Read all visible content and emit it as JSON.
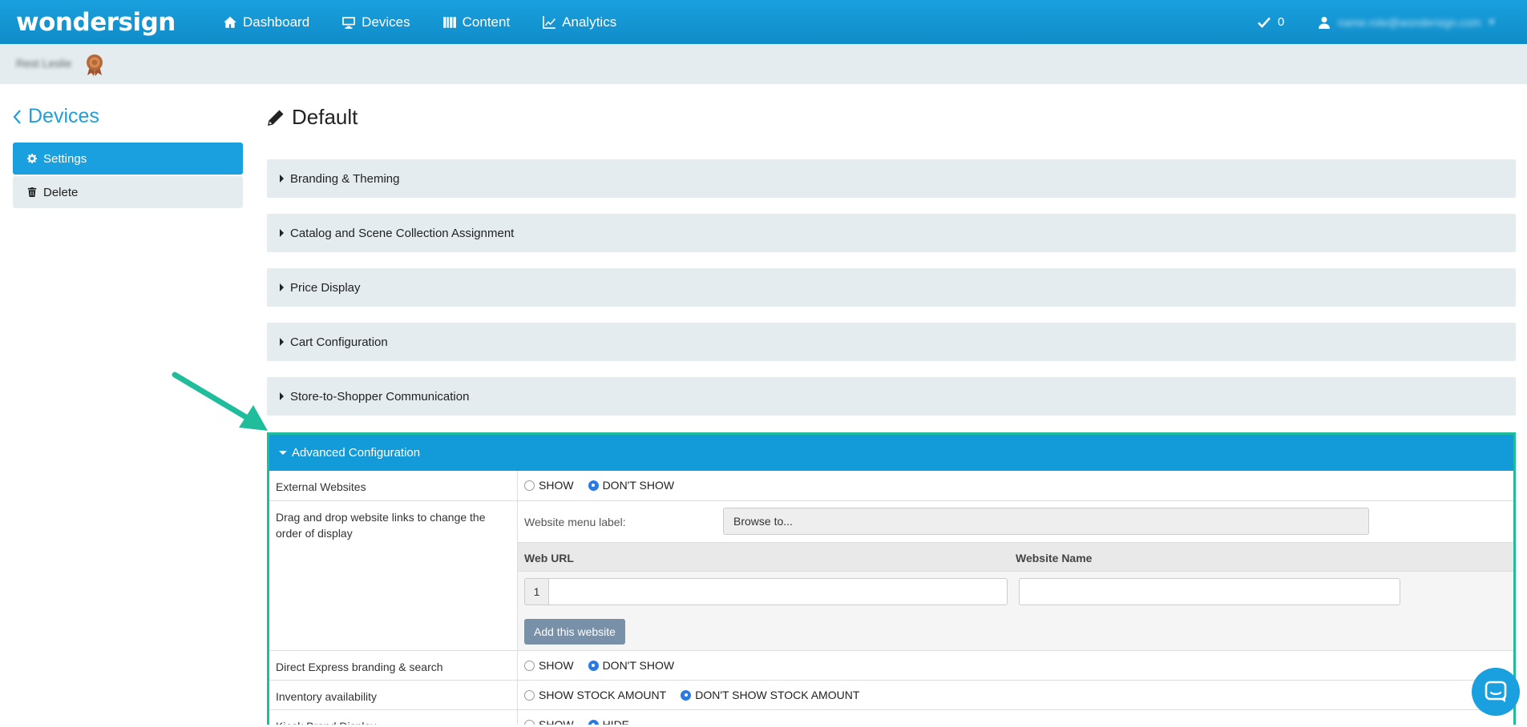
{
  "header": {
    "brand": "wondersign",
    "nav": [
      {
        "label": "Dashboard",
        "icon": "home-icon"
      },
      {
        "label": "Devices",
        "icon": "monitor-icon"
      },
      {
        "label": "Content",
        "icon": "columns-icon"
      },
      {
        "label": "Analytics",
        "icon": "line-chart-icon"
      }
    ],
    "notification_count": "0",
    "user_email": "name.role@wondersign.com"
  },
  "subbar": {
    "account_name": "Rest Leslie"
  },
  "sidebar": {
    "back_label": "Devices",
    "items": [
      {
        "label": "Settings",
        "icon": "gear-icon"
      },
      {
        "label": "Delete",
        "icon": "trash-icon"
      }
    ]
  },
  "main": {
    "title": "Default",
    "panels": [
      "Branding & Theming",
      "Catalog and Scene Collection Assignment",
      "Price Display",
      "Cart Configuration",
      "Store-to-Shopper Communication"
    ],
    "advanced": {
      "title": "Advanced Configuration",
      "external_websites": {
        "label": "External Websites",
        "options": [
          "SHOW",
          "DON'T SHOW"
        ],
        "selected": "DON'T SHOW"
      },
      "websites_order": {
        "label": "Drag and drop website links to change the order of display",
        "menu_label": "Website menu label:",
        "browse_value": "Browse to...",
        "col_url": "Web URL",
        "col_name": "Website Name",
        "row_number": "1",
        "add_button": "Add this website"
      },
      "direct_express": {
        "label": "Direct Express branding & search",
        "options": [
          "SHOW",
          "DON'T SHOW"
        ],
        "selected": "DON'T SHOW"
      },
      "inventory": {
        "label": "Inventory availability",
        "options": [
          "SHOW STOCK AMOUNT",
          "DON'T SHOW STOCK AMOUNT"
        ],
        "selected": "DON'T SHOW STOCK AMOUNT"
      },
      "kiosk_brand": {
        "label": "Kiosk Brand Display",
        "options": [
          "SHOW",
          "HIDE"
        ],
        "selected": "HIDE"
      }
    }
  },
  "colors": {
    "primary": "#1aa0de",
    "annotation": "#1fbd9c"
  }
}
